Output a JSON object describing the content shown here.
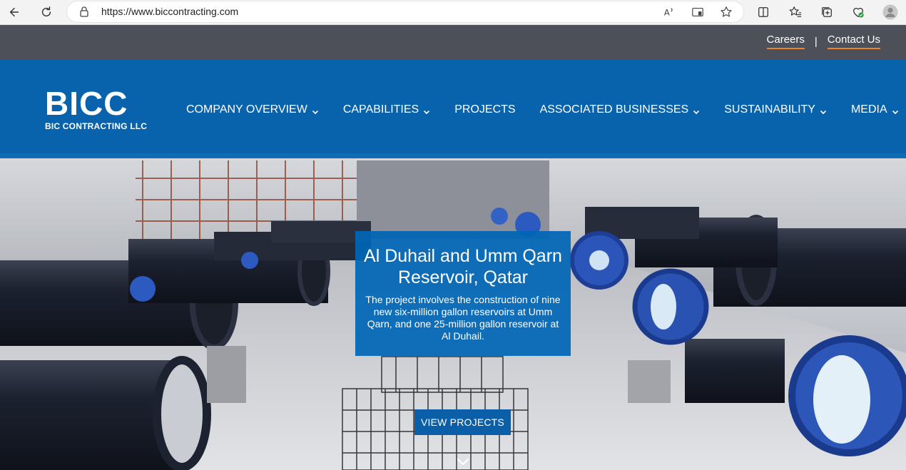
{
  "browser": {
    "url": "https://www.biccontracting.com",
    "icons": [
      "back-icon",
      "refresh-icon",
      "lock-icon",
      "read-aloud-icon",
      "app-available-icon",
      "favorite-star-icon",
      "split-screen-icon",
      "favorites-icon",
      "collections-icon",
      "browser-essentials-icon",
      "profile-icon"
    ]
  },
  "topbar": {
    "careers_label": "Careers",
    "separator": "|",
    "contact_label": "Contact Us",
    "accent": "#e8862f"
  },
  "logo": {
    "main": "BICC",
    "sub": "BIC CONTRACTING LLC"
  },
  "nav": {
    "items": [
      {
        "label": "COMPANY OVERVIEW",
        "dropdown": true
      },
      {
        "label": "CAPABILITIES",
        "dropdown": true
      },
      {
        "label": "PROJECTS",
        "dropdown": false
      },
      {
        "label": "ASSOCIATED BUSINESSES",
        "dropdown": true
      },
      {
        "label": "SUSTAINABILITY",
        "dropdown": true
      },
      {
        "label": "MEDIA",
        "dropdown": true
      }
    ]
  },
  "feature": {
    "title": "Al Duhail and Umm Qarn Reservoir, Qatar",
    "description": "The project involves the construction of nine new six-million gallon reservoirs at Umm Qarn, and one 25-million gallon reservoir at Al Duhail.",
    "cta_label": "VIEW PROJECTS"
  },
  "colors": {
    "brand_blue": "#0062b0",
    "cta_blue": "#0b5fa8"
  }
}
